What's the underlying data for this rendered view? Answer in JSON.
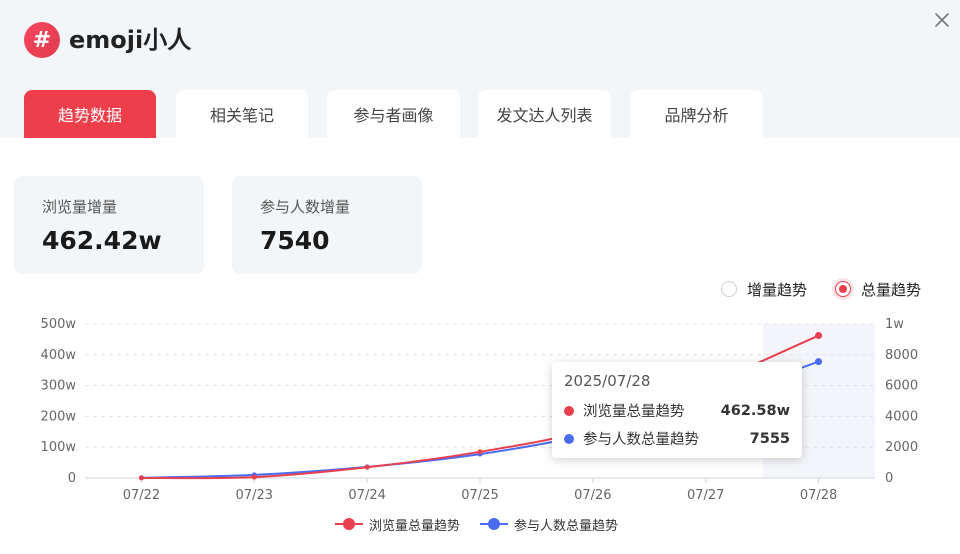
{
  "header": {
    "badge_text": "#",
    "title": "emoji小人",
    "close_icon": "close-icon"
  },
  "tabs": [
    {
      "label": "趋势数据",
      "active": true
    },
    {
      "label": "相关笔记",
      "active": false
    },
    {
      "label": "参与者画像",
      "active": false
    },
    {
      "label": "发文达人列表",
      "active": false
    },
    {
      "label": "品牌分析",
      "active": false
    }
  ],
  "stats": [
    {
      "label": "浏览量增量",
      "value": "462.42w"
    },
    {
      "label": "参与人数增量",
      "value": "7540"
    }
  ],
  "mode_toggle": {
    "options": [
      {
        "label": "增量趋势",
        "selected": false
      },
      {
        "label": "总量趋势",
        "selected": true
      }
    ]
  },
  "colors": {
    "accent": "#ef3e4b",
    "views_series": "#e8404f",
    "participants_series": "#4a6cf0"
  },
  "tooltip": {
    "date": "2025/07/28",
    "rows": [
      {
        "name": "浏览量总量趋势",
        "value": "462.58w"
      },
      {
        "name": "参与人数总量趋势",
        "value": "7555"
      }
    ]
  },
  "chart_data": {
    "type": "line",
    "categories": [
      "07/22",
      "07/23",
      "07/24",
      "07/25",
      "07/26",
      "07/27",
      "07/28"
    ],
    "y_left_ticks": [
      "0",
      "100w",
      "200w",
      "300w",
      "400w",
      "500w"
    ],
    "y_right_ticks": [
      "0",
      "2000",
      "4000",
      "6000",
      "8000",
      "1w"
    ],
    "y_left_range": [
      0,
      500
    ],
    "y_left_unit": "w",
    "y_right_range": [
      0,
      10000
    ],
    "grid": true,
    "highlighted_category": "07/28",
    "legend_position": "bottom",
    "series": [
      {
        "name": "浏览量总量趋势",
        "axis": "left",
        "values": [
          0.16,
          3,
          35,
          85,
          160,
          300,
          462.58
        ]
      },
      {
        "name": "参与人数总量趋势",
        "axis": "right",
        "values": [
          15,
          200,
          720,
          1550,
          2900,
          5000,
          7555
        ]
      }
    ]
  }
}
